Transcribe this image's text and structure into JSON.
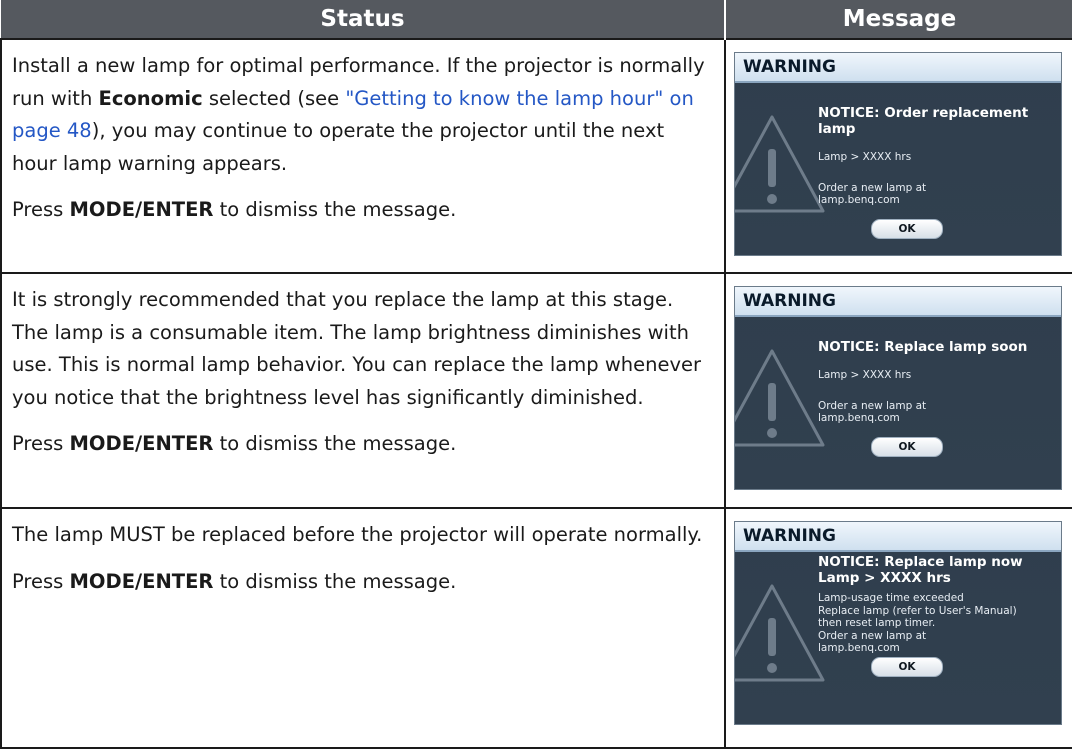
{
  "table": {
    "header_status": "Status",
    "header_message": "Message"
  },
  "rows": [
    {
      "status_parts": {
        "a": "Install a new lamp for optimal performance. If the projector is normally run with ",
        "bold": "Economic",
        "b": " selected (see ",
        "link": "\"Getting to know the lamp hour\" on page 48",
        "c": "), you may continue to operate the projector until the next hour lamp warning appears."
      },
      "press": {
        "pre": "Press ",
        "bold": "MODE/ENTER",
        "post": " to dismiss the message."
      },
      "osd": {
        "header": "WARNING",
        "notice": "NOTICE: Order replacement lamp",
        "lamp_hours": "Lamp > XXXX hrs",
        "order1": "Order a new lamp at",
        "order2": "lamp.benq.com",
        "ok": "OK"
      }
    },
    {
      "status_text": "It is strongly recommended that you replace the lamp at this stage. The lamp is a consumable item. The lamp brightness diminishes with use. This is normal lamp behavior. You can replace the lamp whenever you notice that the brightness level has significantly diminished.",
      "press": {
        "pre": "Press ",
        "bold": "MODE/ENTER",
        "post": " to dismiss the message."
      },
      "osd": {
        "header": "WARNING",
        "notice": "NOTICE: Replace lamp soon",
        "lamp_hours": "Lamp > XXXX hrs",
        "order1": "Order a new lamp at",
        "order2": "lamp.benq.com",
        "ok": "OK"
      }
    },
    {
      "status_text": "The lamp MUST be replaced before the projector will operate normally.",
      "press": {
        "pre": "Press ",
        "bold": "MODE/ENTER",
        "post": " to dismiss the message."
      },
      "osd": {
        "header": "WARNING",
        "notice1": "NOTICE: Replace lamp now",
        "notice2": "Lamp > XXXX hrs",
        "line1": "Lamp-usage time exceeded",
        "line2": "Replace lamp (refer to User's Manual)",
        "line3": "then reset lamp timer.",
        "order1": "Order a new lamp at",
        "order2": "lamp.benq.com",
        "ok": "OK"
      }
    }
  ]
}
